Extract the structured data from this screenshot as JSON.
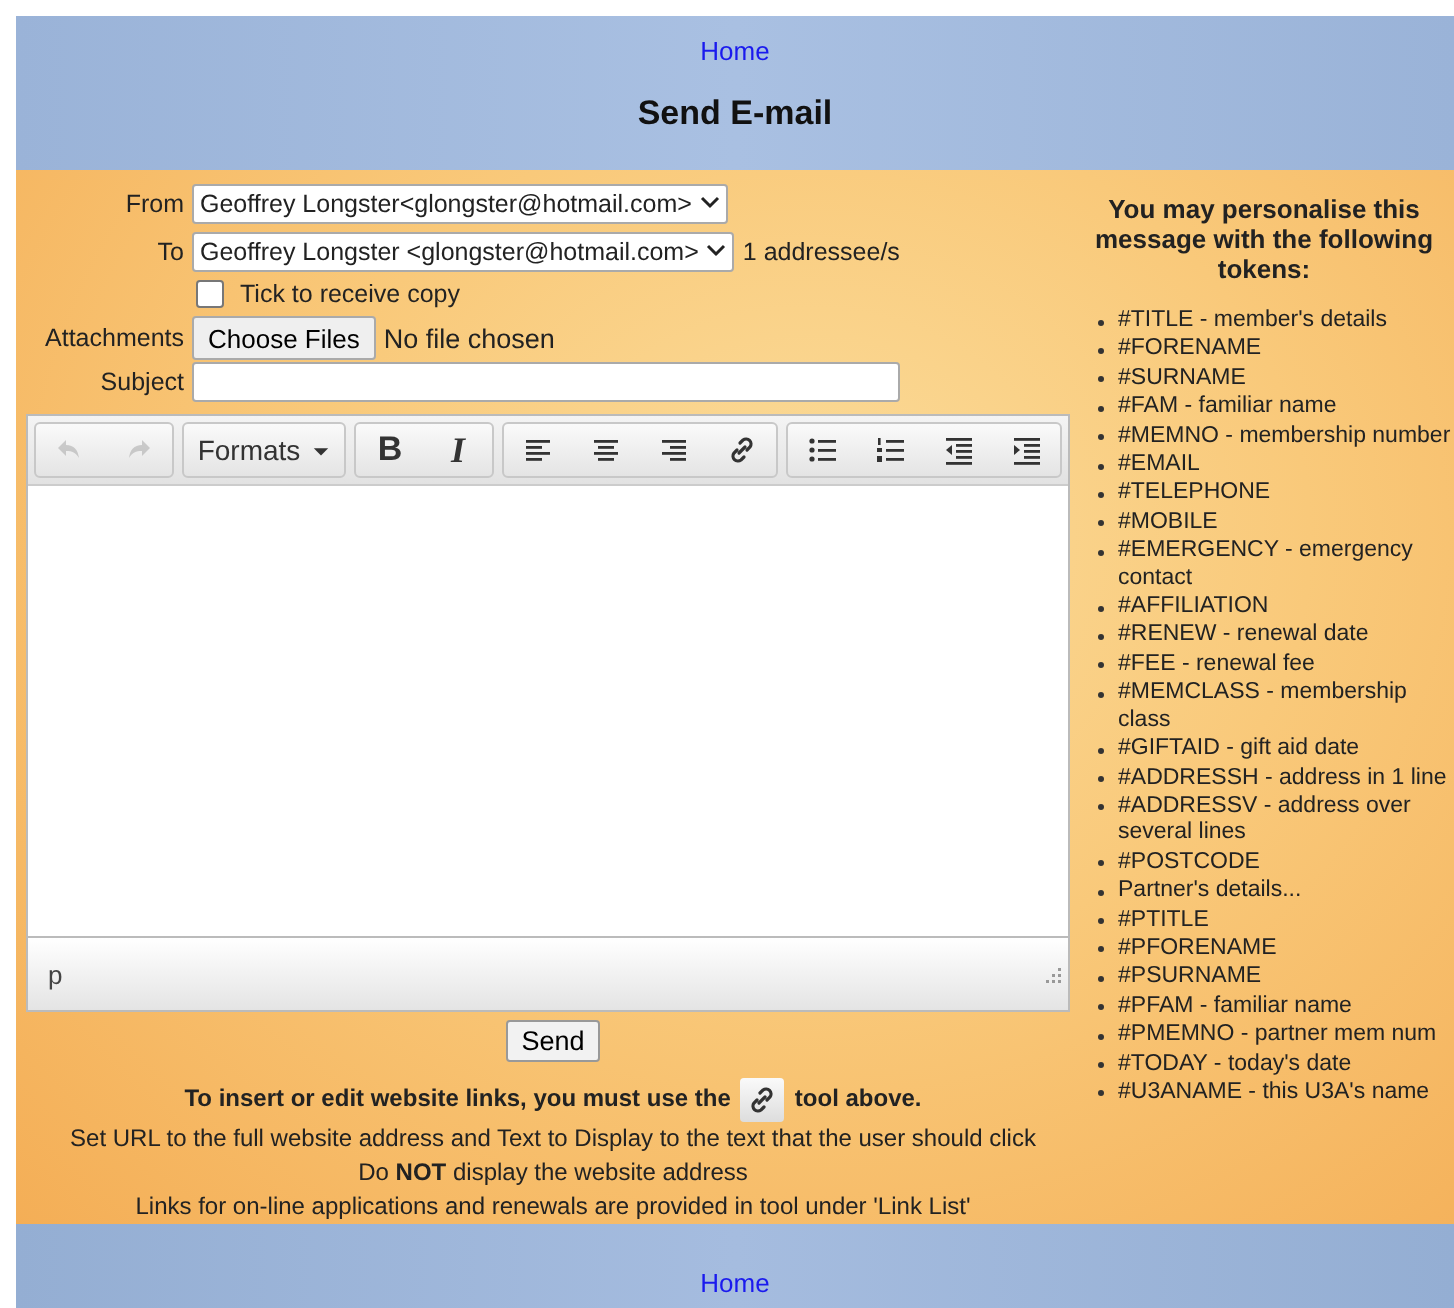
{
  "header": {
    "link": "Home",
    "title": "Send E-mail"
  },
  "form": {
    "from": {
      "label": "From",
      "value": "Geoffrey Longster<glongster@hotmail.com>"
    },
    "to": {
      "label": "To",
      "value": "Geoffrey Longster <glongster@hotmail.com>",
      "count": "1 addressee/s"
    },
    "copy": {
      "label": "Tick to receive copy",
      "checked": false
    },
    "attachments": {
      "label": "Attachments",
      "button": "Choose Files",
      "status": "No file chosen"
    },
    "subject": {
      "label": "Subject"
    }
  },
  "editor": {
    "toolbar": [
      [
        {
          "kind": "undo",
          "disabled": true
        },
        {
          "kind": "redo",
          "disabled": true
        }
      ],
      [
        {
          "kind": "formats",
          "label": "Formats",
          "disabled": false
        }
      ],
      [
        {
          "kind": "bold",
          "label": "B",
          "disabled": false
        },
        {
          "kind": "italic",
          "label": "I",
          "disabled": false
        }
      ],
      [
        {
          "kind": "align-left",
          "disabled": false
        },
        {
          "kind": "align-center",
          "disabled": false
        },
        {
          "kind": "align-right",
          "disabled": false
        },
        {
          "kind": "link",
          "disabled": false
        }
      ],
      [
        {
          "kind": "bullets",
          "disabled": false
        },
        {
          "kind": "numbers",
          "disabled": false
        },
        {
          "kind": "outdent",
          "disabled": false
        },
        {
          "kind": "indent",
          "disabled": false
        }
      ]
    ],
    "path": "p"
  },
  "send": "Send",
  "notes": [
    {
      "kind": "link-tip",
      "before": "To insert or edit website links, you must use the",
      "after": "tool above."
    },
    {
      "kind": "text",
      "text": "Set URL to the full website address and Text to Display to the text that the user should click"
    },
    {
      "kind": "text",
      "text": "Do **NOT** display the website address"
    },
    {
      "kind": "text",
      "text": "Links for on-line applications and renewals are provided in tool under 'Link List'"
    }
  ],
  "tokens": {
    "heading": "You may personalise this message with the following tokens:",
    "items": [
      "#TITLE - member's details",
      "#FORENAME",
      "#SURNAME",
      "#FAM - familiar name",
      "#MEMNO - membership number",
      "#EMAIL",
      "#TELEPHONE",
      "#MOBILE",
      "#EMERGENCY - emergency contact",
      "#AFFILIATION",
      "#RENEW - renewal date",
      "#FEE - renewal fee",
      "#MEMCLASS - membership class",
      "#GIFTAID - gift aid date",
      "#ADDRESSH - address in 1 line",
      "#ADDRESSV - address over several lines",
      "#POSTCODE",
      "Partner's details...",
      "#PTITLE",
      "#PFORENAME",
      "#PSURNAME",
      "#PFAM - familiar name",
      "#PMEMNO - partner mem num",
      "#TODAY - today's date",
      "#U3ANAME - this U3A's name"
    ]
  },
  "footer": {
    "link": "Home"
  }
}
